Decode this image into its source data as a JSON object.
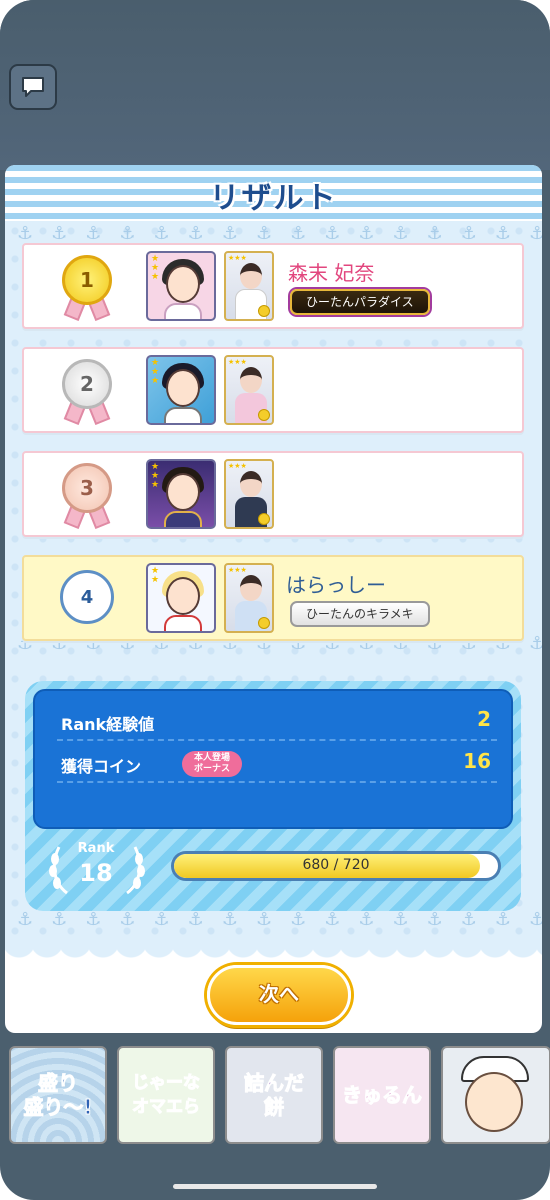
{
  "title": "リザルト",
  "results": [
    {
      "rank": "1",
      "name": "森末 妃奈",
      "badge": "ひーたんパラダイス",
      "highlight": false
    },
    {
      "rank": "2",
      "name": "",
      "badge": "",
      "highlight": false
    },
    {
      "rank": "3",
      "name": "",
      "badge": "",
      "highlight": false
    },
    {
      "rank": "4",
      "name": "はらっしー",
      "badge": "ひーたんのキラメキ",
      "highlight": true
    }
  ],
  "rewards": {
    "rank_exp_label": "Rank経験値",
    "rank_exp_value": "2",
    "coin_label": "獲得コイン",
    "coin_value": "16",
    "bonus_line1": "本人登場",
    "bonus_line2": "ボーナス"
  },
  "rank": {
    "label": "Rank",
    "value": "18",
    "progress_text": "680 / 720",
    "progress_fraction": 0.944
  },
  "next_button": "次へ",
  "stamps": [
    {
      "text": "盛り\n盛り〜!"
    },
    {
      "text": "じゃーな\nオマエら"
    },
    {
      "text": "詰んだ\n餅"
    },
    {
      "text": "きゅるん"
    },
    {
      "text": ""
    }
  ],
  "colors": {
    "accent_blue": "#1a73d6",
    "gold": "#f2c91c",
    "button_orange": "#f5a20a",
    "name_pink": "#e2467e"
  }
}
